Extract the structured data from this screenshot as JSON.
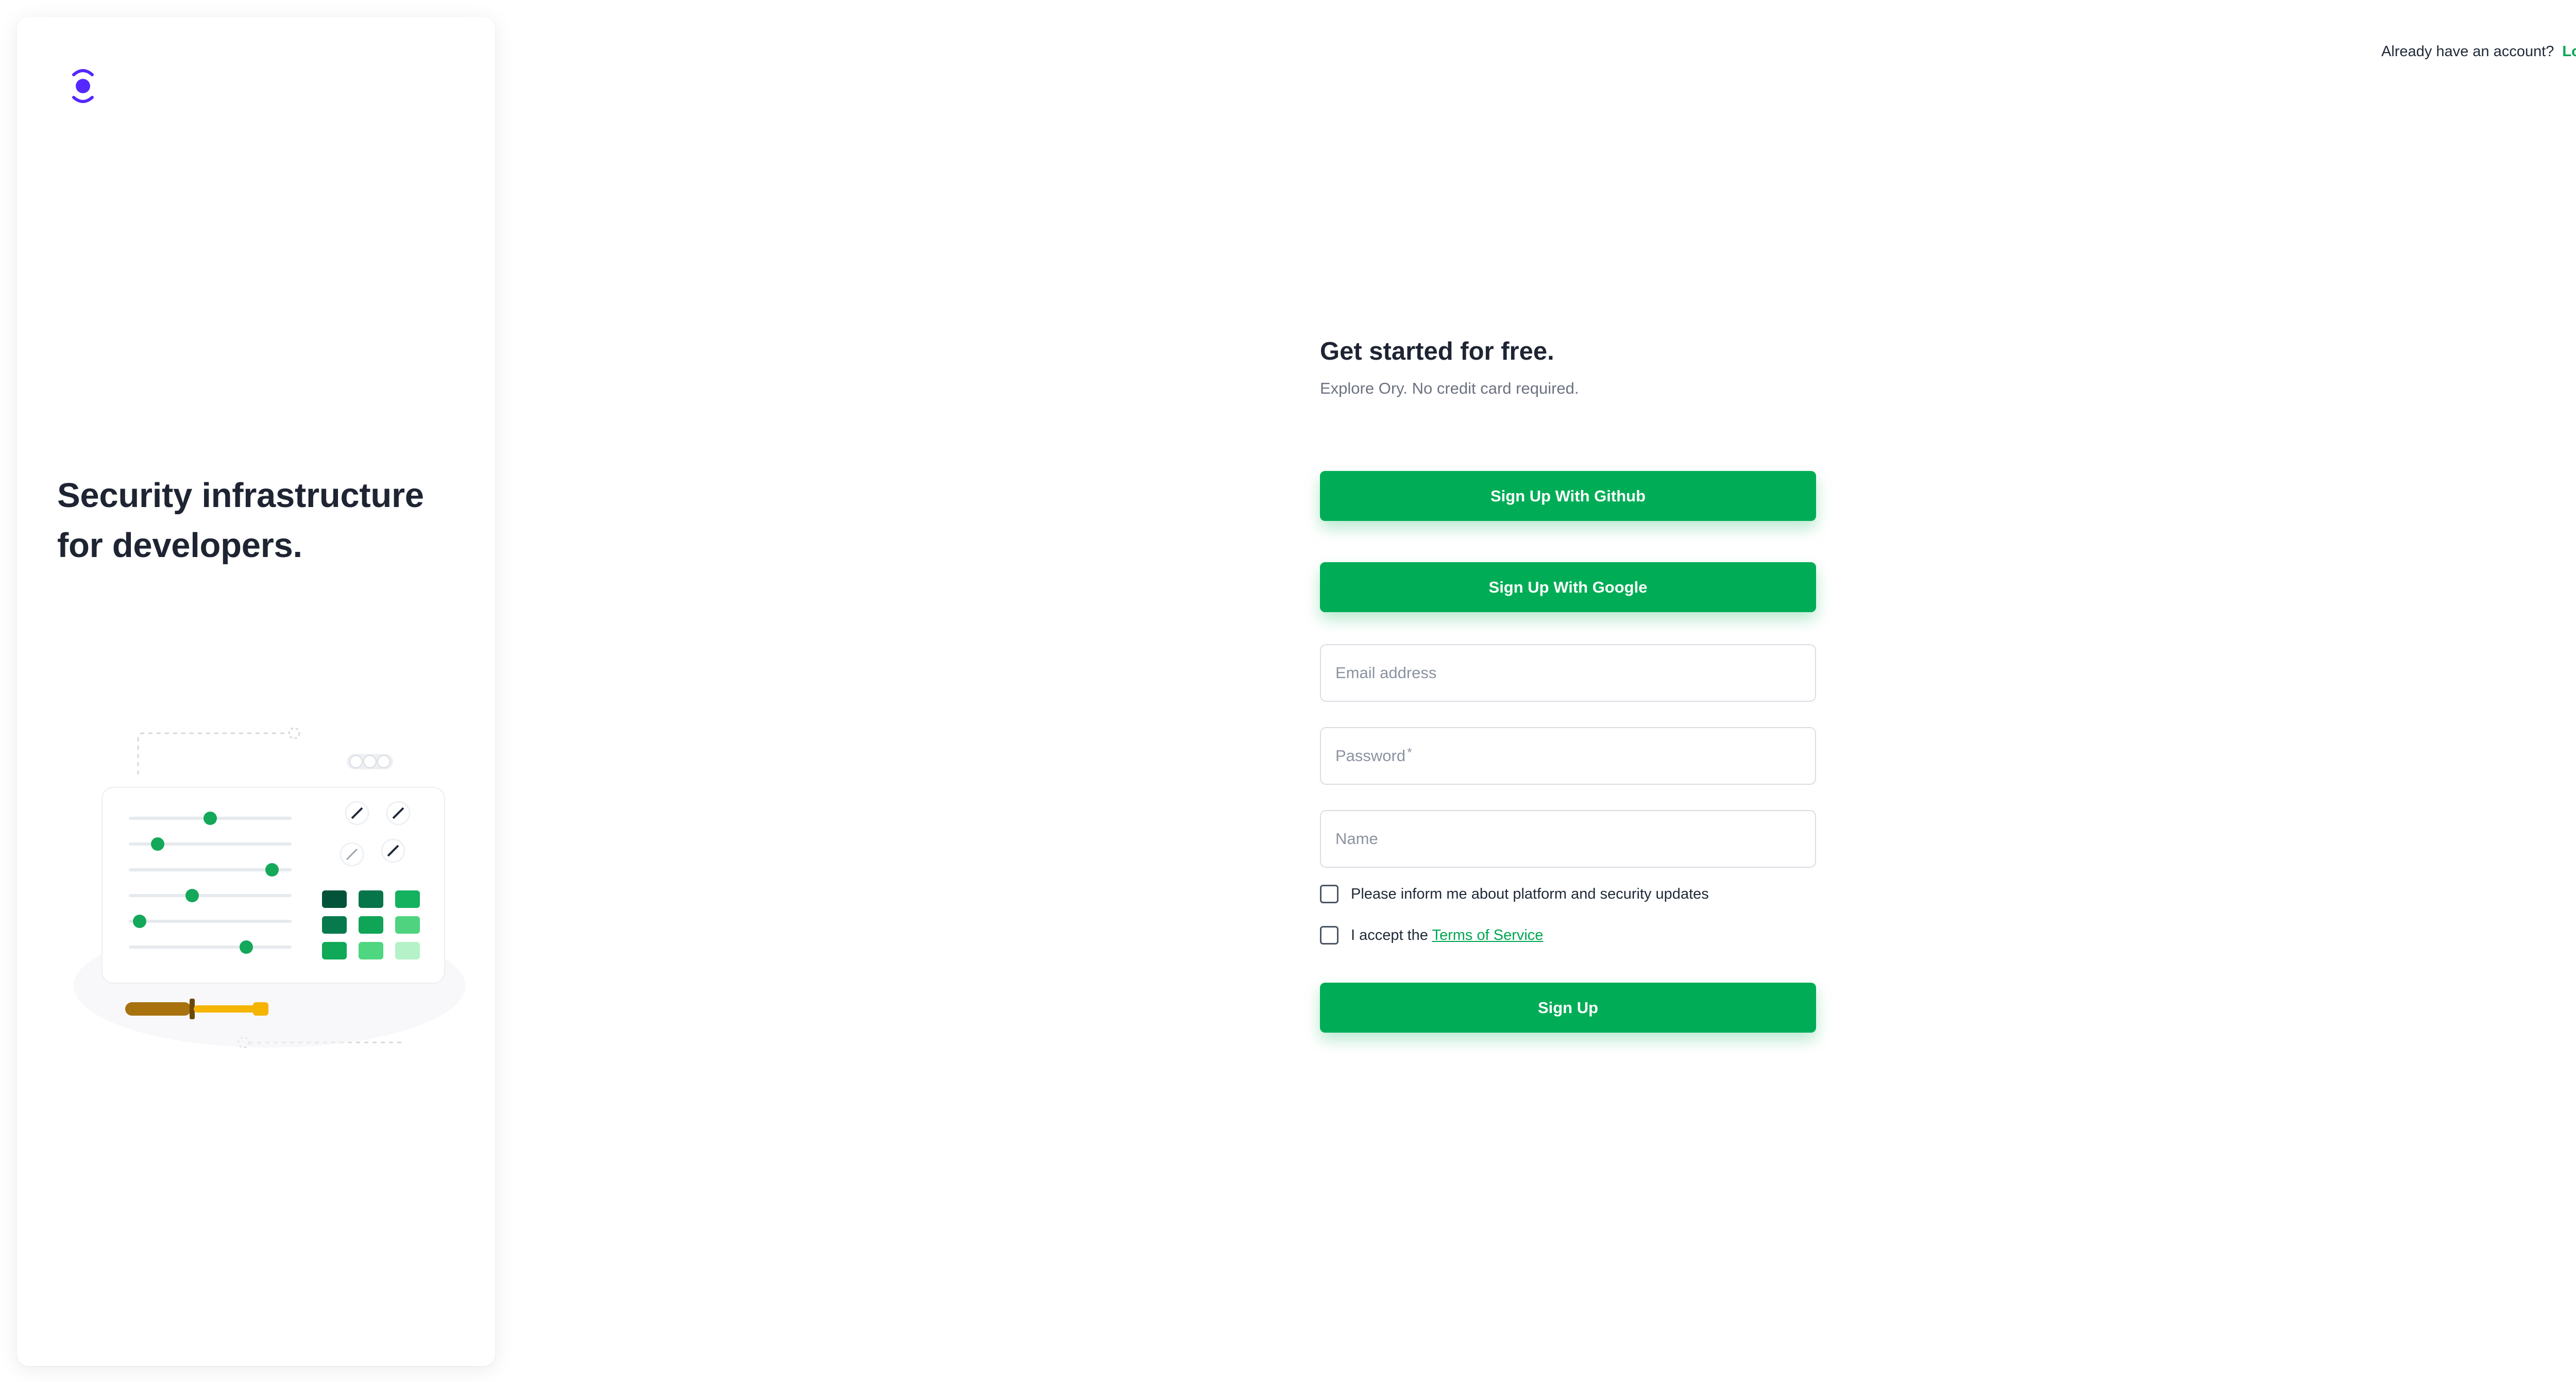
{
  "header": {
    "login_prompt": "Already have an account?",
    "login_link": "Login!"
  },
  "left_panel": {
    "tagline_line1": "Security infrastructure",
    "tagline_line2": "for developers.",
    "logo_icon": "ory-logo-icon",
    "brand_color": "#5528ff"
  },
  "form": {
    "title": "Get started for free.",
    "subtitle": "Explore Ory. No credit card required.",
    "github_button": "Sign Up With Github",
    "google_button": "Sign Up With Google",
    "email_placeholder": "Email address",
    "password_placeholder": "Password",
    "password_required_mark": "*",
    "name_placeholder": "Name",
    "newsletter_label": "Please inform me about platform and security updates",
    "terms_prefix": "I accept the",
    "terms_link": "Terms of Service",
    "submit_button": "Sign Up"
  },
  "colors": {
    "accent": "#00ad56",
    "link": "#00a651",
    "text": "#1e2432",
    "muted": "#6b7280"
  }
}
